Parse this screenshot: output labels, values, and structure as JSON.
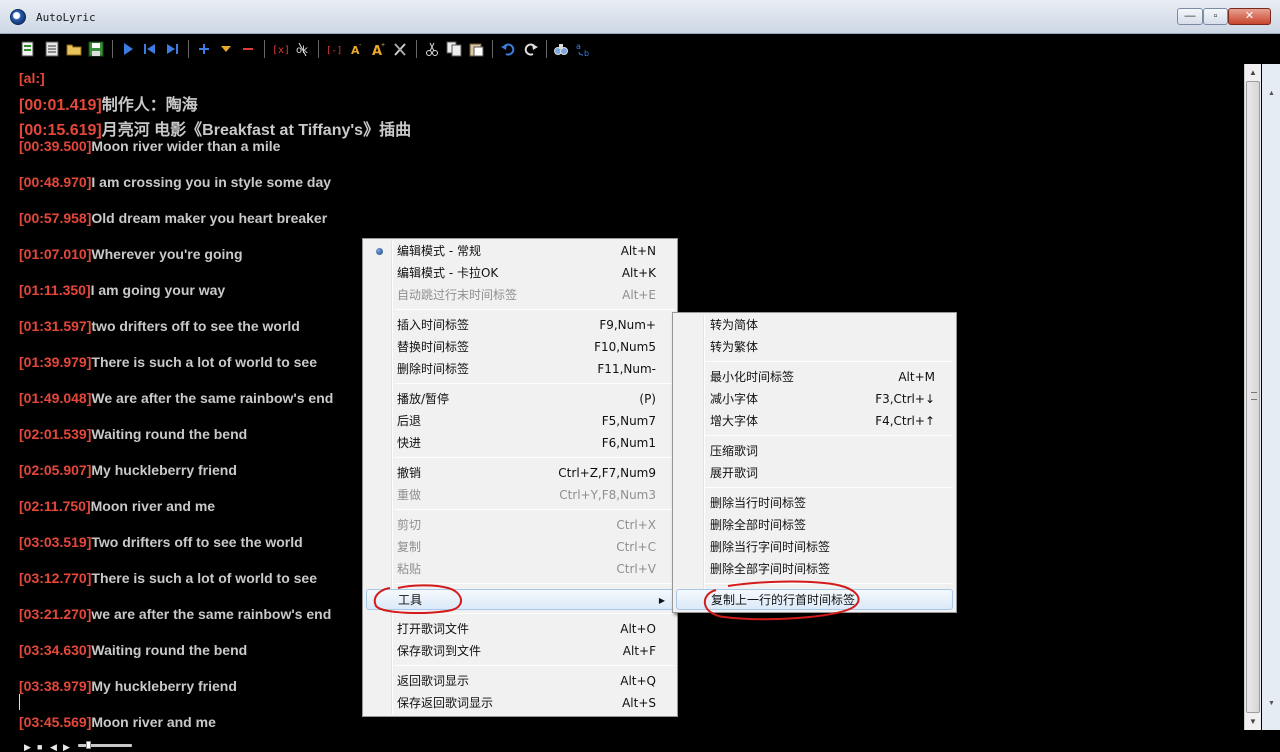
{
  "window": {
    "title": "AutoLyric",
    "min_glyph": "—",
    "max_glyph": "▫",
    "close_glyph": "✕"
  },
  "colors": {
    "timestamp": "#e5473a",
    "lyric_text": "#c9c9c9",
    "background": "#000000",
    "menu_bg": "#f1f1f1",
    "annotation": "#d41b1b"
  },
  "toolbar": {
    "buttons": [
      "new-file-icon",
      "list-icon",
      "open-folder-icon",
      "save-icon",
      "play-icon",
      "step-back-icon",
      "step-forward-icon",
      "add-icon",
      "dropdown-icon",
      "remove-icon",
      "timetag-icon",
      "karaoke-icon",
      "compress-icon",
      "font-decrease-icon",
      "font-increase-icon",
      "tools-icon",
      "cut-icon",
      "copy-icon",
      "paste-icon",
      "undo-icon",
      "redo-icon",
      "find-icon",
      "replace-icon"
    ]
  },
  "lyrics": [
    {
      "ts": "[al:]",
      "text": ""
    },
    {
      "ts": "[00:01.419]",
      "text": "制作人：陶海"
    },
    {
      "ts": "[00:15.619]",
      "text": "月亮河 电影《Breakfast at Tiffany's》插曲"
    },
    {
      "ts": "[00:39.500]",
      "text": "Moon river wider than a mile"
    },
    {
      "ts": "[00:48.970]",
      "text": "I am crossing you in style some day"
    },
    {
      "ts": "[00:57.958]",
      "text": "Old dream maker  you heart breaker"
    },
    {
      "ts": "[01:07.010]",
      "text": "Wherever you're going"
    },
    {
      "ts": "[01:11.350]",
      "text": "I am going your way"
    },
    {
      "ts": "[01:31.597]",
      "text": "two drifters off to see the world"
    },
    {
      "ts": "[01:39.979]",
      "text": "There is such a lot of world to see"
    },
    {
      "ts": "[01:49.048]",
      "text": "We are after the same rainbow's end"
    },
    {
      "ts": "[02:01.539]",
      "text": "Waiting round the bend"
    },
    {
      "ts": "[02:05.907]",
      "text": "My huckleberry friend"
    },
    {
      "ts": "[02:11.750]",
      "text": "Moon river and me"
    },
    {
      "ts": "[03:03.519]",
      "text": "Two drifters off to see the world"
    },
    {
      "ts": "[03:12.770]",
      "text": "There is such a lot of world to see"
    },
    {
      "ts": "[03:21.270]",
      "text": "we are after the same rainbow's end"
    },
    {
      "ts": "[03:34.630]",
      "text": "Waiting round the bend"
    },
    {
      "ts": "[03:38.979]",
      "text": "My huckleberry friend"
    },
    {
      "ts": "[03:45.569]",
      "text": "Moon river and me"
    }
  ],
  "context_menu": {
    "items": [
      {
        "label": "编辑模式 - 常规",
        "shortcut": "Alt+N",
        "checked": true
      },
      {
        "label": "编辑模式 - 卡拉OK",
        "shortcut": "Alt+K"
      },
      {
        "label": "自动跳过行末时间标签",
        "shortcut": "Alt+E",
        "disabled": true
      },
      {
        "label": "插入时间标签",
        "shortcut": "F9,Num+"
      },
      {
        "label": "替换时间标签",
        "shortcut": "F10,Num5"
      },
      {
        "label": "删除时间标签",
        "shortcut": "F11,Num-"
      },
      {
        "label": "播放/暂停",
        "shortcut": "(P)"
      },
      {
        "label": "后退",
        "shortcut": "F5,Num7"
      },
      {
        "label": "快进",
        "shortcut": "F6,Num1"
      },
      {
        "label": "撤销",
        "shortcut": "Ctrl+Z,F7,Num9"
      },
      {
        "label": "重做",
        "shortcut": "Ctrl+Y,F8,Num3",
        "disabled": true
      },
      {
        "label": "剪切",
        "shortcut": "Ctrl+X",
        "disabled": true
      },
      {
        "label": "复制",
        "shortcut": "Ctrl+C",
        "disabled": true
      },
      {
        "label": "粘贴",
        "shortcut": "Ctrl+V",
        "disabled": true
      },
      {
        "label": "工具",
        "shortcut": "",
        "submenu": true,
        "highlighted": true
      },
      {
        "label": "打开歌词文件",
        "shortcut": "Alt+O"
      },
      {
        "label": "保存歌词到文件",
        "shortcut": "Alt+F"
      },
      {
        "label": "返回歌词显示",
        "shortcut": "Alt+Q"
      },
      {
        "label": "保存返回歌词显示",
        "shortcut": "Alt+S"
      }
    ],
    "submenu_arrow": "▶"
  },
  "tools_submenu": {
    "items": [
      {
        "label": "转为简体",
        "shortcut": ""
      },
      {
        "label": "转为繁体",
        "shortcut": ""
      },
      {
        "label": "最小化时间标签",
        "shortcut": "Alt+M"
      },
      {
        "label": "减小字体",
        "shortcut": "F3,Ctrl+↓"
      },
      {
        "label": "增大字体",
        "shortcut": "F4,Ctrl+↑"
      },
      {
        "label": "压缩歌词",
        "shortcut": ""
      },
      {
        "label": "展开歌词",
        "shortcut": ""
      },
      {
        "label": "删除当行时间标签",
        "shortcut": ""
      },
      {
        "label": "删除全部时间标签",
        "shortcut": ""
      },
      {
        "label": "删除当行字间时间标签",
        "shortcut": ""
      },
      {
        "label": "删除全部字间时间标签",
        "shortcut": ""
      },
      {
        "label": "复制上一行的行首时间标签",
        "shortcut": "",
        "highlighted": true
      }
    ]
  },
  "scrollbar": {
    "up_arrow": "▲",
    "down_arrow": "▼",
    "position": 0.0
  },
  "player": {
    "play": "▶",
    "stop": "■",
    "prev": "◀",
    "next": "▶",
    "progress": 0.15
  }
}
